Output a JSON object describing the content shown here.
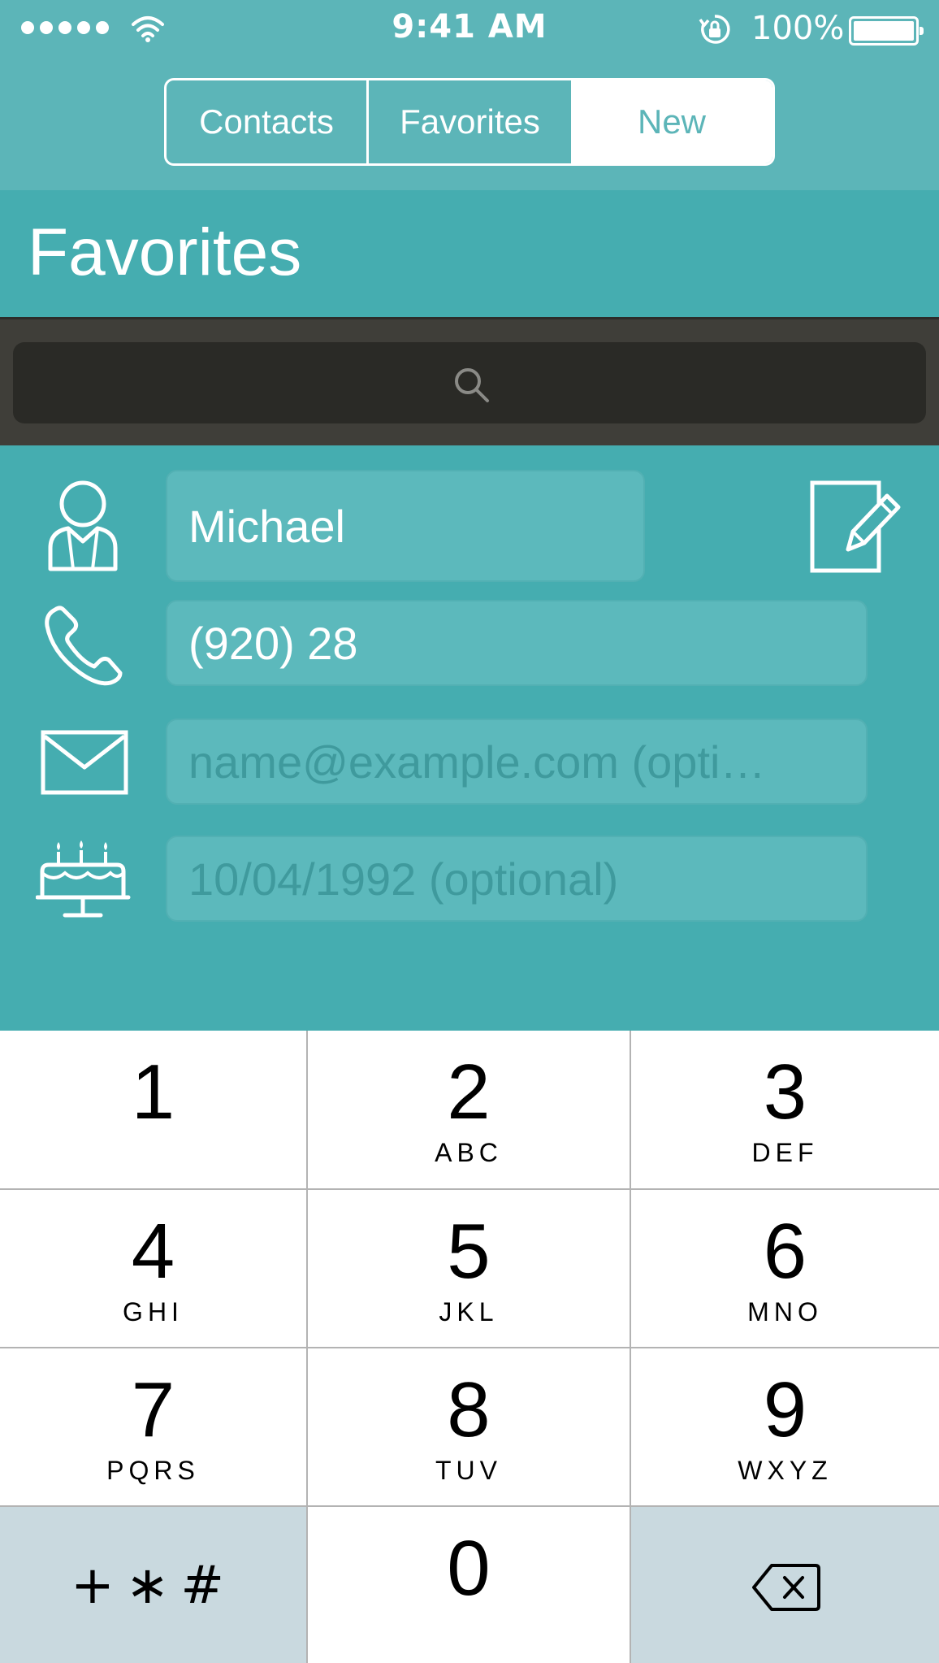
{
  "status": {
    "time": "9:41 AM",
    "battery": "100%"
  },
  "nav": {
    "tabs": [
      {
        "label": "Contacts"
      },
      {
        "label": "Favorites"
      },
      {
        "label": "New"
      }
    ],
    "selected": "New"
  },
  "page": {
    "title": "Favorites"
  },
  "search": {
    "icon": "search-icon"
  },
  "form": {
    "name_value": "Michael",
    "phone_value": "(920) 28",
    "email_placeholder": "name@example.com (opti…",
    "birthday_placeholder": "10/04/1992 (optional)"
  },
  "keypad": {
    "keys": [
      {
        "digit": "1",
        "letters": ""
      },
      {
        "digit": "2",
        "letters": "ABC"
      },
      {
        "digit": "3",
        "letters": "DEF"
      },
      {
        "digit": "4",
        "letters": "GHI"
      },
      {
        "digit": "5",
        "letters": "JKL"
      },
      {
        "digit": "6",
        "letters": "MNO"
      },
      {
        "digit": "7",
        "letters": "PQRS"
      },
      {
        "digit": "8",
        "letters": "TUV"
      },
      {
        "digit": "9",
        "letters": "WXYZ"
      },
      {
        "digit": "0",
        "letters": ""
      }
    ],
    "symbols": "+∗#"
  },
  "colors": {
    "header": "#5cb5b8",
    "accent": "#45adb0",
    "search_bg": "#3f3e39",
    "key_gray": "#c9d9df"
  }
}
